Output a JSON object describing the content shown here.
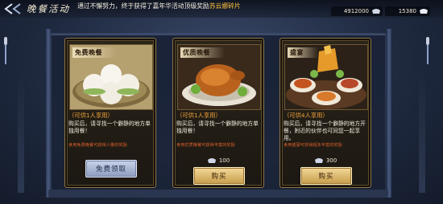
{
  "header": {
    "title": "晚餐活动",
    "notice_prefix": "通过不懈努力，终于获得了嘉年华活动顶级奖励",
    "notice_highlight": "苏云娜碎片",
    "currencies": [
      {
        "value": "4912000",
        "icon": "silver-ingot-icon"
      },
      {
        "value": "15380",
        "icon": "gold-ingot-icon"
      }
    ]
  },
  "cards": [
    {
      "tag": "免费晚餐",
      "note": "（可供1人享用）",
      "desc": "购买后，请寻找一个僻静的地方单独用餐！",
      "tip": "食用免费晚餐可获得少量的奖励",
      "price": "",
      "button": "免费领取",
      "button_style": "free"
    },
    {
      "tag": "优质晚餐",
      "note": "（可供1人享用）",
      "desc": "购买后，请寻找一个僻静的地方单独用餐！",
      "tip": "食用优质晚餐可获得丰富的奖励",
      "price": "100",
      "button": "购买",
      "button_style": "buy"
    },
    {
      "tag": "盛宴",
      "note": "（可供4人享用）",
      "desc": "购买后，请寻找一个僻静的地方开餐，附近的伙伴也可同您一起享用。",
      "tip": "食用盛宴可获得超多丰富的奖励",
      "price": "300",
      "button": "购买",
      "button_style": "buy"
    }
  ],
  "colors": {
    "highlight": "#ffc13b",
    "note": "#f0a23a",
    "tip": "#d95e2c"
  }
}
